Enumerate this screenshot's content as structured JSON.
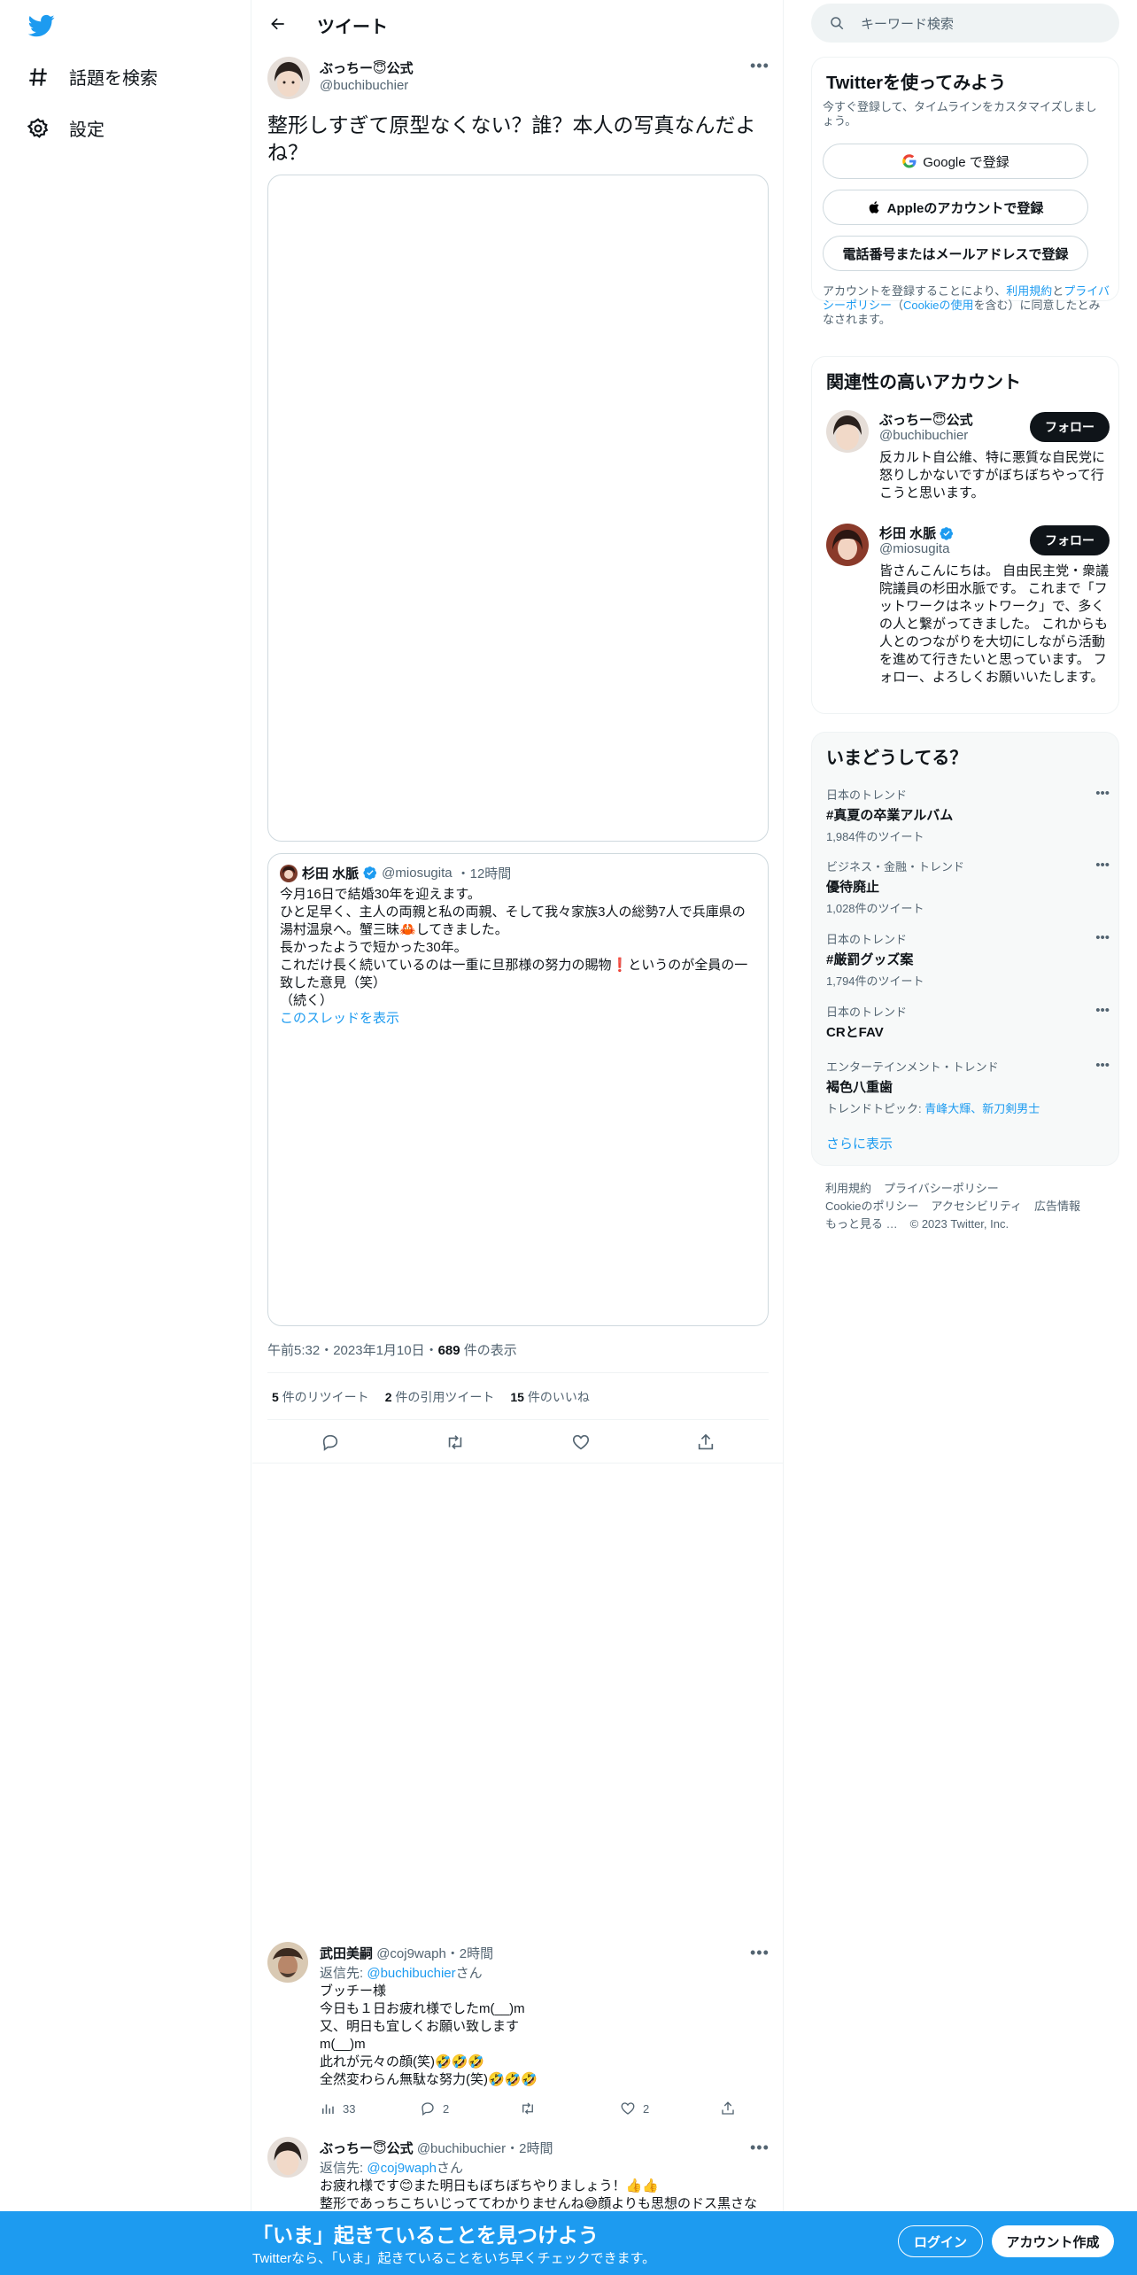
{
  "nav": {
    "explore": "話題を検索",
    "settings": "設定"
  },
  "header": {
    "title": "ツイート"
  },
  "main_tweet": {
    "name": "ぶっちー😇公式",
    "handle": "@buchibuchier",
    "text": "整形しすぎて原型なくない？誰？本人の写真なんだよね？",
    "time": "午前5:32・2023年1月10日・",
    "views_count": "689",
    "views_label": " 件の表示",
    "retweets": "5",
    "retweets_label": " 件のリツイート",
    "quotes": "2",
    "quotes_label": " 件の引用ツイート",
    "likes": "15",
    "likes_label": " 件のいいね"
  },
  "quoted": {
    "name": "杉田 水脈",
    "handle": "@miosugita",
    "time": "・12時間",
    "text": "今月16日で結婚30年を迎えます。\nひと足早く、主人の両親と私の両親、そして我々家族3人の総勢7人で兵庫県の湯村温泉へ。蟹三昧🦀してきました。\n長かったようで短かった30年。\nこれだけ長く続いているのは一重に旦那様の努力の賜物❗️というのが全員の一致した意見（笑）\n（続く）",
    "thread_link": "このスレッドを表示"
  },
  "replies": [
    {
      "name": "武田美嗣",
      "handle": "@coj9waph",
      "time": "・2時間",
      "reply_to_prefix": "返信先: ",
      "reply_to": "@buchibuchier",
      "reply_to_suffix": "さん",
      "text": "ブッチー様\n今日も１日お疲れ様でしたm(__)m\n又、明日も宜しくお願い致します\nm(__)m\n此れが元々の顔(笑)🤣🤣🤣\n全然変わらん無駄な努力(笑)🤣🤣🤣",
      "views": "33",
      "reply_count": "2",
      "like_count": "2"
    },
    {
      "name": "ぶっちー😇公式",
      "handle": "@buchibuchier",
      "time": "・2時間",
      "reply_to_prefix": "返信先: ",
      "reply_to": "@coj9waph",
      "reply_to_suffix": "さん",
      "text": "お疲れ様です😊また明日もぼちぼちやりましょう！👍👍\n整形であっちこちいじっててわかりませんね😅顔よりも思想のドス黒さな"
    }
  ],
  "right": {
    "search_placeholder": "キーワード検索",
    "signup": {
      "title": "Twitterを使ってみよう",
      "subtitle": "今すぐ登録して、タイムラインをカスタマイズしましょう。",
      "google": "Google で登録",
      "apple": "Appleのアカウントで登録",
      "phone": "電話番号またはメールアドレスで登録",
      "legal_1": "アカウントを登録することにより、",
      "legal_terms": "利用規約",
      "legal_2": "と",
      "legal_privacy": "プライバシーポリシー",
      "legal_3": "（",
      "legal_cookie": "Cookieの使用",
      "legal_4": "を含む）に同意したとみなされます。"
    },
    "related": {
      "title": "関連性の高いアカウント",
      "follow": "フォロー",
      "accounts": [
        {
          "name": "ぶっちー😇公式",
          "handle": "@buchibuchier",
          "bio": "反カルト自公維、特に悪質な自民党に怒りしかないですがぼちぼちやって行こうと思います。"
        },
        {
          "name": "杉田 水脈",
          "handle": "@miosugita",
          "bio": "皆さんこんにちは。 自由民主党・衆議院議員の杉田水脈です。 これまで「フットワークはネットワーク」で、多くの人と繋がってきました。 これからも人とのつながりを大切にしながら活動を進めて行きたいと思っています。 フォロー、よろしくお願いいたします。"
        }
      ]
    },
    "trends": {
      "title": "いまどうしてる？",
      "items": [
        {
          "context": "日本のトレンド",
          "title": "#真夏の卒業アルバム",
          "count": "1,984件のツイート"
        },
        {
          "context": "ビジネス・金融・トレンド",
          "title": "優待廃止",
          "count": "1,028件のツイート"
        },
        {
          "context": "日本のトレンド",
          "title": "#厳罰グッズ案",
          "count": "1,794件のツイート"
        },
        {
          "context": "日本のトレンド",
          "title": "CRとFAV",
          "count": ""
        },
        {
          "context": "エンターテインメント・トレンド",
          "title": "褐色八重歯",
          "count_prefix": "トレンドトピック: ",
          "topics": "青峰大輝、新刀剣男士"
        }
      ],
      "show_more": "さらに表示"
    },
    "footer": {
      "terms": "利用規約",
      "privacy": "プライバシーポリシー",
      "cookie": "Cookieのポリシー",
      "accessibility": "アクセシビリティ",
      "ads": "広告情報",
      "more": "もっと見る …",
      "copyright": "© 2023 Twitter, Inc."
    }
  },
  "bottom": {
    "headline": "「いま」起きていることを見つけよう",
    "sub": "Twitterなら、「いま」起きていることをいち早くチェックできます。",
    "login": "ログイン",
    "signup": "アカウント作成"
  },
  "colors": {
    "brand": "#1d9bf0",
    "text": "#0f1419",
    "muted": "#536471"
  }
}
